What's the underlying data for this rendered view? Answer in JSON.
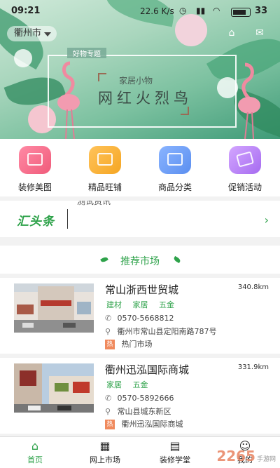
{
  "status_bar": {
    "time": "09:21",
    "network": "22.6 K/s",
    "battery": "33"
  },
  "header": {
    "city": "衢州市"
  },
  "banner": {
    "tag": "好物专题",
    "subtitle": "家居小物",
    "title": "网红火烈鸟"
  },
  "quick_menu": [
    {
      "label": "装修美图",
      "color": "#f05b7a",
      "icon": "image-icon"
    },
    {
      "label": "精品旺铺",
      "color": "#f5a623",
      "icon": "shop-icon"
    },
    {
      "label": "商品分类",
      "color": "#5b8ff0",
      "icon": "list-icon"
    },
    {
      "label": "促销活动",
      "color": "#a66bf0",
      "icon": "ticket-icon"
    }
  ],
  "headline": {
    "logo": "汇头条",
    "text": "测试资讯"
  },
  "recommend": {
    "title": "推荐市场"
  },
  "markets": [
    {
      "name": "常山浙西世贸城",
      "distance": "340.8km",
      "tags": [
        "建材",
        "家居",
        "五金"
      ],
      "phone": "0570-5668812",
      "address": "衢州市常山县定阳南路787号",
      "hot_badge": "热",
      "hot_text": "热门市场"
    },
    {
      "name": "衢州迅泓国际商城",
      "distance": "331.9km",
      "tags": [
        "家居",
        "五金"
      ],
      "phone": "0570-5892666",
      "address": "常山县城东新区",
      "hot_badge": "热",
      "hot_text": "衢州迅泓国际商城"
    }
  ],
  "bottom_nav": [
    {
      "label": "首页",
      "icon": "home-icon",
      "active": true
    },
    {
      "label": "网上市场",
      "icon": "building-icon",
      "active": false
    },
    {
      "label": "装修学堂",
      "icon": "book-icon",
      "active": false
    },
    {
      "label": "我的",
      "icon": "user-icon",
      "active": false
    }
  ],
  "watermark": {
    "brand": "2265",
    "site": "手游网"
  },
  "colors": {
    "accent": "#2ea24a",
    "hot": "#f08a5d"
  }
}
